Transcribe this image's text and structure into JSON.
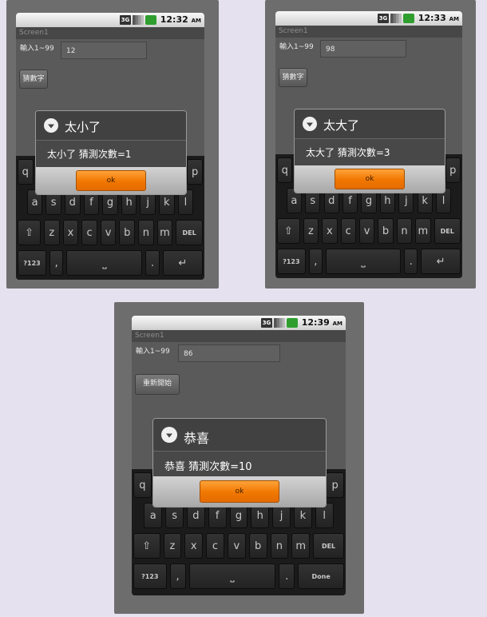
{
  "screens": [
    {
      "status": {
        "network": "3G",
        "clock": "12:32",
        "ampm": "AM"
      },
      "app_title": "Screen1",
      "input_label": "輸入1~99",
      "input_value": "12",
      "button_label": "猜數字",
      "dialog": {
        "title": "太小了",
        "message": "太小了 猜測次數=1",
        "ok_label": "ok"
      },
      "keyboard": {
        "rows": [
          [
            "q",
            "",
            "",
            "",
            "",
            "",
            "",
            "",
            "",
            "p"
          ],
          [
            "a",
            "s",
            "d",
            "f",
            "g",
            "h",
            "j",
            "k",
            "l"
          ],
          [
            "z",
            "x",
            "c",
            "v",
            "b",
            "n",
            "m"
          ]
        ],
        "symbols_key": "?123",
        "comma_key": ",",
        "space_key": "⎵",
        "period_key": ".",
        "del_key": "DEL",
        "action_key": "↵"
      }
    },
    {
      "status": {
        "network": "3G",
        "clock": "12:33",
        "ampm": "AM"
      },
      "app_title": "Screen1",
      "input_label": "輸入1~99",
      "input_value": "98",
      "button_label": "猜數字",
      "dialog": {
        "title": "太大了",
        "message": "太大了 猜測次數=3",
        "ok_label": "ok"
      },
      "keyboard": {
        "rows": [
          [
            "q",
            "",
            "",
            "",
            "",
            "",
            "",
            "",
            "",
            "p"
          ],
          [
            "a",
            "s",
            "d",
            "f",
            "g",
            "h",
            "j",
            "k",
            "l"
          ],
          [
            "z",
            "x",
            "c",
            "v",
            "b",
            "n",
            "m"
          ]
        ],
        "symbols_key": "?123",
        "comma_key": ",",
        "space_key": "⎵",
        "period_key": ".",
        "del_key": "DEL",
        "action_key": "↵"
      }
    },
    {
      "status": {
        "network": "3G",
        "clock": "12:39",
        "ampm": "AM"
      },
      "app_title": "Screen1",
      "input_label": "輸入1~99",
      "input_value": "86",
      "button_label": "重新開始",
      "dialog": {
        "title": "恭喜",
        "message": "恭喜 猜測次數=10",
        "ok_label": "ok"
      },
      "keyboard": {
        "rows": [
          [
            "q",
            "",
            "",
            "",
            "",
            "",
            "",
            "",
            "",
            "p"
          ],
          [
            "a",
            "s",
            "d",
            "f",
            "g",
            "h",
            "j",
            "k",
            "l"
          ],
          [
            "z",
            "x",
            "c",
            "v",
            "b",
            "n",
            "m"
          ]
        ],
        "symbols_key": "?123",
        "comma_key": ",",
        "space_key": "⎵",
        "period_key": ".",
        "del_key": "DEL",
        "action_key": "Done"
      }
    }
  ]
}
